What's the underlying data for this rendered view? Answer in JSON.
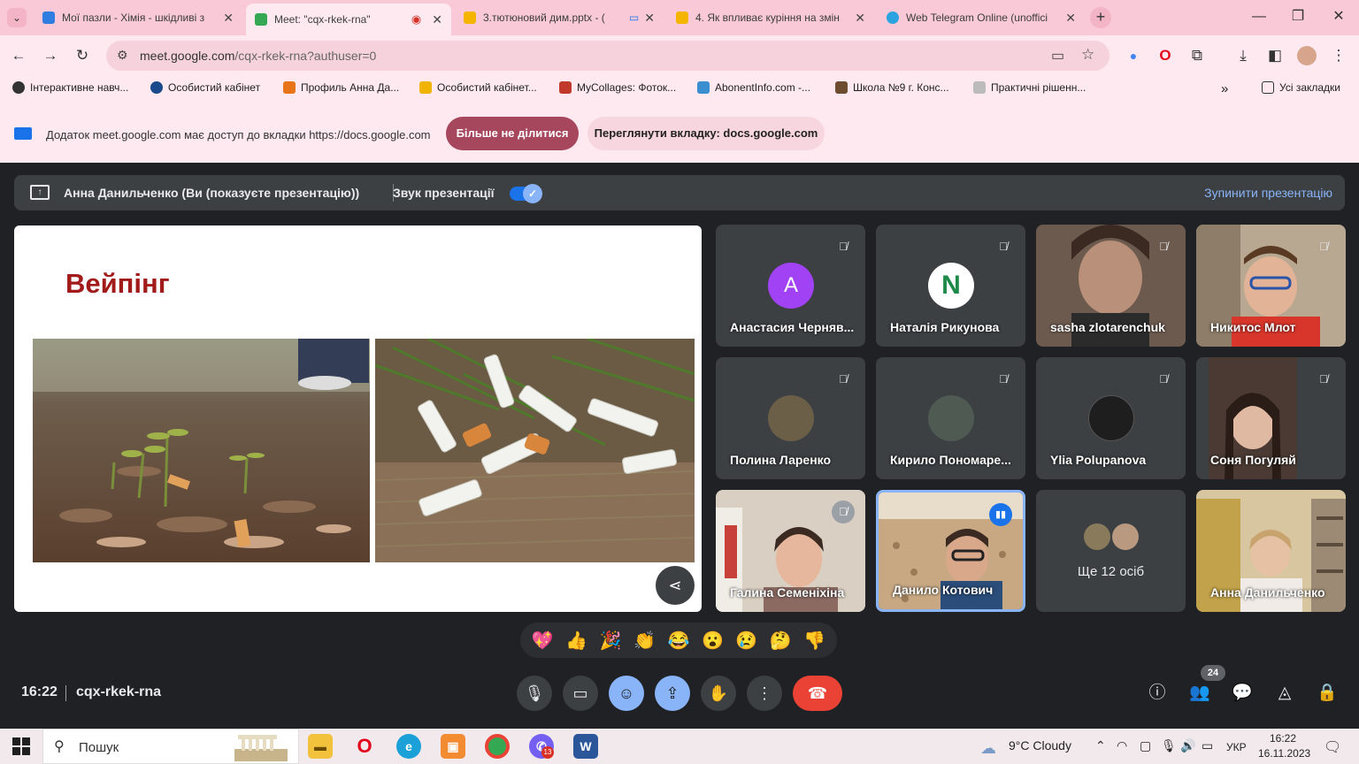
{
  "browser": {
    "tabs": [
      {
        "title": "Мої пазли - Хімія - шкідливі з",
        "color": "#2f7de1"
      },
      {
        "title": "Meet: \"cqx-rkek-rna\"",
        "color": "#34a853"
      },
      {
        "title": "3.тютюновий дим.pptx - (",
        "color": "#f4b400"
      },
      {
        "title": "4. Як впливає куріння на змін",
        "color": "#f4b400"
      },
      {
        "title": "Web Telegram Online (unoffici",
        "color": "#2aa3e0"
      }
    ],
    "url_host": "meet.google.com",
    "url_path": "/cqx-rkek-rna?authuser=0",
    "bookmarks": [
      "Інтерактивне навч...",
      "Особистий кабінет",
      "Профиль Анна Да...",
      "Особистий кабінет...",
      "MyCollages: Фоток...",
      "AbonentInfo.com -...",
      "Школа №9 г. Конс...",
      "Практичні рішенн..."
    ],
    "all_bookmarks": "Усі закладки",
    "more_bookmarks": "»",
    "infobar": {
      "message": "Додаток meet.google.com має доступ до вкладки https://docs.google.com",
      "stop_sharing": "Більше не ділитися",
      "view_tab": "Переглянути вкладку: docs.google.com"
    }
  },
  "meet": {
    "presenting_label": "Анна Данильченко (Ви (показуєте презентацію))",
    "audio_label": "Звук презентації",
    "stop_label": "Зупинити презентацію",
    "slide_title": "Вейпінг",
    "participants": [
      {
        "name": "Анастасия Черняв...",
        "avatar": "A",
        "avatar_color": "#a142f4"
      },
      {
        "name": "Наталія Рикунова",
        "avatar": "N",
        "avatar_color": "#ffffff"
      },
      {
        "name": "sasha zlotarenchuk",
        "avatar": "",
        "avatar_color": "#6d5a4e"
      },
      {
        "name": "Никитос Млот",
        "avatar": "",
        "avatar_color": "#9c8a7a"
      },
      {
        "name": "Полина Ларенко",
        "avatar": "",
        "avatar_color": "#6b5f48"
      },
      {
        "name": "Кирило Пономаре...",
        "avatar": "",
        "avatar_color": "#4e5a52"
      },
      {
        "name": "Ylia Polupanova",
        "avatar": "",
        "avatar_color": "#1e1e1e"
      },
      {
        "name": "Соня Погуляй",
        "avatar": "",
        "avatar_color": "#4a3a33"
      },
      {
        "name": "Галина Семеніхіна",
        "avatar": "",
        "avatar_color": "#c9b39d"
      },
      {
        "name": "Данило Котович",
        "avatar": "",
        "avatar_color": "#b7956d"
      },
      {
        "name": "Ще 12 осіб",
        "avatar": "",
        "avatar_color": "#3c4043"
      },
      {
        "name": "Анна Данильченко",
        "avatar": "",
        "avatar_color": "#c2a882"
      }
    ],
    "reactions": [
      "💖",
      "👍",
      "🎉",
      "👏",
      "😂",
      "😮",
      "😢",
      "🤔",
      "👎"
    ],
    "time": "16:22",
    "meeting_code": "cqx-rkek-rna",
    "people_count": "24"
  },
  "taskbar": {
    "search_placeholder": "Пошук",
    "weather": "9°C  Cloudy",
    "language": "УКР",
    "time": "16:22",
    "date": "16.11.2023",
    "viber_badge": "13"
  }
}
